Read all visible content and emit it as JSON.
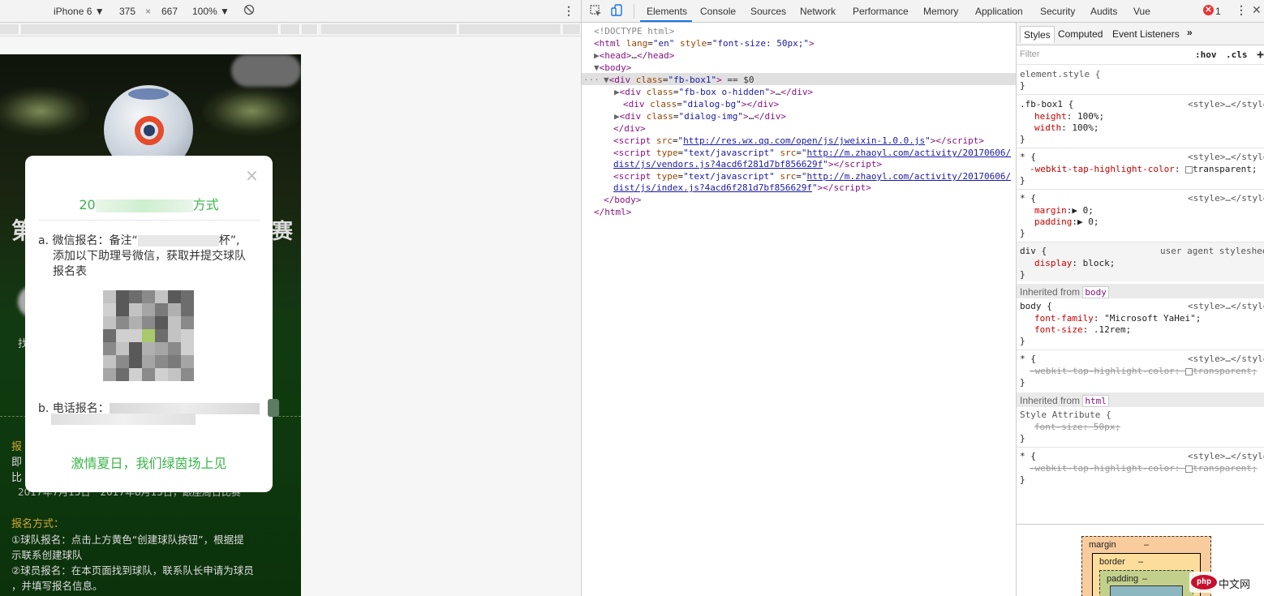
{
  "device_toolbar": {
    "device": "iPhone 6",
    "width": "375",
    "times": "×",
    "height": "667",
    "zoom": "100%",
    "rotate_icon": "rotate-icon",
    "more_icon": "more-vertical-icon"
  },
  "phone_page": {
    "dialog": {
      "close": "×",
      "title_left": "20",
      "title_right": "方式",
      "a_prefix": "a. 微信报名：备注“",
      "a_mid": "杯”,",
      "a_line2": "添加以下助理号微信，获取并提交球队",
      "a_line3": "报名表",
      "b_label": "b. 电话报名：",
      "footer": "激情夏日，我们绿茵场上见"
    },
    "bg_text": {
      "left_big": "第",
      "right_big": "赛",
      "small_left": "报",
      "line_ji": "即",
      "line_bi": "比",
      "date_line": "2017年7月15日一2017年8月15日，跟座周日比赛",
      "method_title": "报名方式：",
      "method1_a": "①球队报名：点击上方黄色“创建球队按钮”，根据提",
      "method1_b": "示联系创建球队",
      "method2_a": "②球员报名：在本页面找到球队，联系队长申请为球员",
      "method2_b": "，并填写报名信息。",
      "side_zhao": "找"
    }
  },
  "devtools": {
    "tabs": [
      "Elements",
      "Console",
      "Sources",
      "Network",
      "Performance",
      "Memory",
      "Application",
      "Security",
      "Audits",
      "Vue"
    ],
    "active_tab": "Elements",
    "error_count": "1",
    "elements": {
      "doctype": "<!DOCTYPE html>",
      "html_open_tag": "html",
      "html_attr1_name": "lang",
      "html_attr1_val": "\"en\"",
      "html_attr2_name": "style",
      "html_attr2_val": "\"font-size: 50px;\"",
      "head": "head",
      "body": "body",
      "sel_div_class": "\"fb-box1\"",
      "sel_suffix": " == $0",
      "child1_class": "\"fb-box o-hidden\"",
      "child2_class": "\"dialog-bg\"",
      "child3_class": "\"dialog-img\"",
      "script1_src": "http://res.wx.qq.com/open/js/jweixin-1.0.0.js",
      "script2_type": "\"text/javascript\"",
      "script2_src_a": "http://m.zhaoyl.com/activity/20170606/",
      "script2_src_b": "dist/js/vendors.js?4acd6f281d7bf856629f",
      "script3_type": "\"text/javascript\"",
      "script3_src_a": "http://m.zhaoyl.com/activity/20170606/",
      "script3_src_b": "dist/js/index.js?4acd6f281d7bf856629f"
    },
    "styles_panel": {
      "tabs": [
        "Styles",
        "Computed",
        "Event Listeners"
      ],
      "filter_placeholder": "Filter",
      "hov": ":hov",
      "cls": ".cls",
      "plus": "+",
      "element_style": "element.style {",
      "close_brace": "}",
      "rule1_sel": ".fb-box1 {",
      "style_src": "<style>…</style>",
      "height_prop": "height",
      "height_val": "100%;",
      "width_prop": "width",
      "width_val": "100%;",
      "star_sel": "* {",
      "tap_prop": "-webkit-tap-highlight-color",
      "tap_val": "transparent;",
      "margin_prop": "margin",
      "margin_val": "0;",
      "padding_prop": "padding",
      "padding_val": "0;",
      "div_sel": "div {",
      "ua_src": "user agent stylesheet",
      "display_prop": "display",
      "display_val": "block;",
      "inherited_from": "Inherited from",
      "inh_body": "body",
      "body_sel": "body {",
      "ff_prop": "font-family",
      "ff_val": "\"Microsoft YaHei\";",
      "fs_prop": "font-size",
      "fs_val": ".12rem;",
      "inh_html": "html",
      "style_attr": "Style Attribute {",
      "fs50": "font-size: 50px;",
      "tap_strike": "-webkit-tap-highlight-color:",
      "box_margin": "margin",
      "box_border": "border",
      "box_padding": "padding",
      "dash": "–"
    },
    "watermark": "php中文网"
  },
  "colors": {
    "accent_green": "#3ab54a",
    "devtools_blue": "#1a73e8"
  }
}
